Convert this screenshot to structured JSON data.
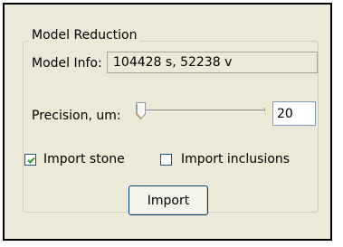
{
  "group": {
    "title": "Model Reduction"
  },
  "model_info": {
    "label": "Model Info:",
    "value": "104428 s, 52238 v"
  },
  "precision": {
    "label": "Precision, um:",
    "slider_position_fraction": 0.0,
    "value": "20"
  },
  "checkboxes": {
    "import_stone": {
      "label": "Import stone",
      "checked": true
    },
    "import_inclusions": {
      "label": "Import inclusions",
      "checked": false
    }
  },
  "import_button": {
    "label": "Import"
  },
  "colors": {
    "panel_background": "#ece9d8",
    "frame_border": "#000000",
    "button_border": "#003c74",
    "checkbox_border": "#1c5180",
    "check_mark": "#21a121",
    "input_border": "#7f9db9"
  },
  "icons": {
    "check": "check-mark-icon",
    "slider_thumb": "slider-thumb-icon"
  }
}
